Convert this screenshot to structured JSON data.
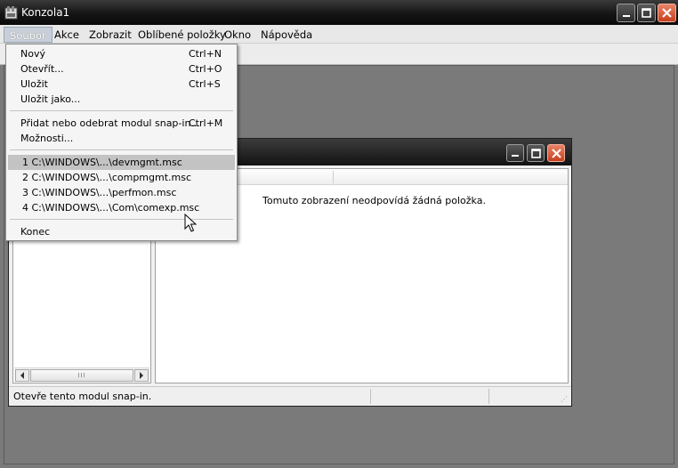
{
  "window": {
    "title": "Konzola1"
  },
  "menubar": {
    "items": [
      "Soubor",
      "Akce",
      "Zobrazit",
      "Oblíbené položky",
      "Okno",
      "Nápověda"
    ]
  },
  "file_menu": {
    "items": [
      {
        "label": "Nový",
        "shortcut": "Ctrl+N"
      },
      {
        "label": "Otevřít...",
        "shortcut": "Ctrl+O"
      },
      {
        "label": "Uložit",
        "shortcut": "Ctrl+S"
      },
      {
        "label": "Uložit jako...",
        "shortcut": ""
      },
      {
        "label": "Přidat nebo odebrat modul snap-in...",
        "shortcut": "Ctrl+M"
      },
      {
        "label": "Možnosti...",
        "shortcut": ""
      },
      {
        "label": "1 C:\\WINDOWS\\...\\devmgmt.msc",
        "shortcut": ""
      },
      {
        "label": "2 C:\\WINDOWS\\...\\compmgmt.msc",
        "shortcut": ""
      },
      {
        "label": "3 C:\\WINDOWS\\...\\perfmon.msc",
        "shortcut": ""
      },
      {
        "label": "4 C:\\WINDOWS\\...\\Com\\comexp.msc",
        "shortcut": ""
      },
      {
        "label": "Konec",
        "shortcut": ""
      }
    ],
    "highlighted_index": 6
  },
  "child_window": {
    "empty_message": "Tomuto zobrazení neodpovídá žádná položka.",
    "scrollbar_grip": "III"
  },
  "statusbar": {
    "text": "Otevře tento modul snap-in."
  },
  "colors": {
    "titlebar": "#151515",
    "close_button": "#c7401e",
    "menu_highlight": "#c3c3c3",
    "workspace": "#7a7a7a"
  },
  "icons": [
    "app-icon",
    "minimize-icon",
    "maximize-icon",
    "close-icon",
    "scroll-left-icon",
    "scroll-right-icon",
    "mouse-cursor-icon"
  ]
}
